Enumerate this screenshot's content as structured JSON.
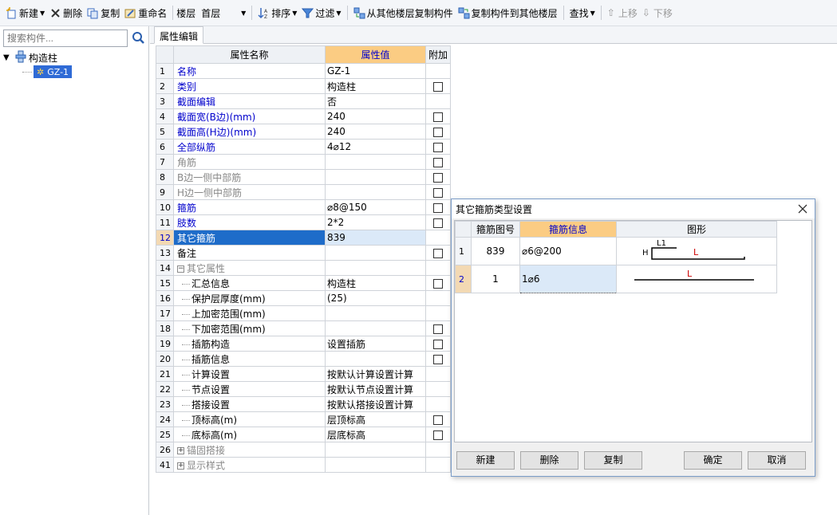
{
  "toolbar": {
    "new": "新建",
    "delete": "删除",
    "copy": "复制",
    "rename": "重命名",
    "floor_label": "楼层",
    "floor_value": "首层",
    "sort": "排序",
    "filter": "过滤",
    "copy_from_floor": "从其他楼层复制构件",
    "copy_to_floor": "复制构件到其他楼层",
    "find": "查找",
    "move_up": "上移",
    "move_down": "下移"
  },
  "search": {
    "placeholder": "搜索构件..."
  },
  "tree": {
    "root": "构造柱",
    "child": "GZ-1"
  },
  "tab": {
    "label": "属性编辑"
  },
  "grid": {
    "headers": {
      "name": "属性名称",
      "value": "属性值",
      "extra": "附加"
    },
    "rows": [
      {
        "idx": "1",
        "name": "名称",
        "value": "GZ-1"
      },
      {
        "idx": "2",
        "name": "类别",
        "value": "构造柱"
      },
      {
        "idx": "3",
        "name": "截面编辑",
        "value": "否"
      },
      {
        "idx": "4",
        "name": "截面宽(B边)(mm)",
        "value": "240"
      },
      {
        "idx": "5",
        "name": "截面高(H边)(mm)",
        "value": "240"
      },
      {
        "idx": "6",
        "name": "全部纵筋",
        "value": "4⌀12"
      },
      {
        "idx": "7",
        "name": "角筋",
        "value": ""
      },
      {
        "idx": "8",
        "name": "B边一侧中部筋",
        "value": ""
      },
      {
        "idx": "9",
        "name": "H边一侧中部筋",
        "value": ""
      },
      {
        "idx": "10",
        "name": "箍筋",
        "value": "⌀8@150"
      },
      {
        "idx": "11",
        "name": "肢数",
        "value": "2*2"
      },
      {
        "idx": "12",
        "name": "其它箍筋",
        "value": "839"
      },
      {
        "idx": "13",
        "name": "备注",
        "value": ""
      },
      {
        "idx": "14",
        "name": "其它属性",
        "value": ""
      },
      {
        "idx": "15",
        "name": "汇总信息",
        "value": "构造柱"
      },
      {
        "idx": "16",
        "name": "保护层厚度(mm)",
        "value": "(25)"
      },
      {
        "idx": "17",
        "name": "上加密范围(mm)",
        "value": ""
      },
      {
        "idx": "18",
        "name": "下加密范围(mm)",
        "value": ""
      },
      {
        "idx": "19",
        "name": "插筋构造",
        "value": "设置插筋"
      },
      {
        "idx": "20",
        "name": "插筋信息",
        "value": ""
      },
      {
        "idx": "21",
        "name": "计算设置",
        "value": "按默认计算设置计算"
      },
      {
        "idx": "22",
        "name": "节点设置",
        "value": "按默认节点设置计算"
      },
      {
        "idx": "23",
        "name": "搭接设置",
        "value": "按默认搭接设置计算"
      },
      {
        "idx": "24",
        "name": "顶标高(m)",
        "value": "层顶标高"
      },
      {
        "idx": "25",
        "name": "底标高(m)",
        "value": "层底标高"
      },
      {
        "idx": "26",
        "name": "锚固搭接",
        "value": ""
      },
      {
        "idx": "41",
        "name": "显示样式",
        "value": ""
      }
    ]
  },
  "dialog": {
    "title": "其它箍筋类型设置",
    "headers": {
      "shape_no": "箍筋图号",
      "info": "箍筋信息",
      "figure": "图形"
    },
    "rows": [
      {
        "idx": "1",
        "shape_no": "839",
        "info": "⌀6@200"
      },
      {
        "idx": "2",
        "shape_no": "1",
        "info": "1⌀6"
      }
    ],
    "figure_labels": {
      "h": "H",
      "l1": "L1",
      "l": "L"
    },
    "buttons": {
      "new": "新建",
      "delete": "删除",
      "copy": "复制",
      "ok": "确定",
      "cancel": "取消"
    }
  },
  "colors": {
    "accent": "#1e6cc9",
    "header_highlight": "#fbcc83",
    "label_blue": "#0000cc",
    "figure_red": "#cc0000"
  }
}
